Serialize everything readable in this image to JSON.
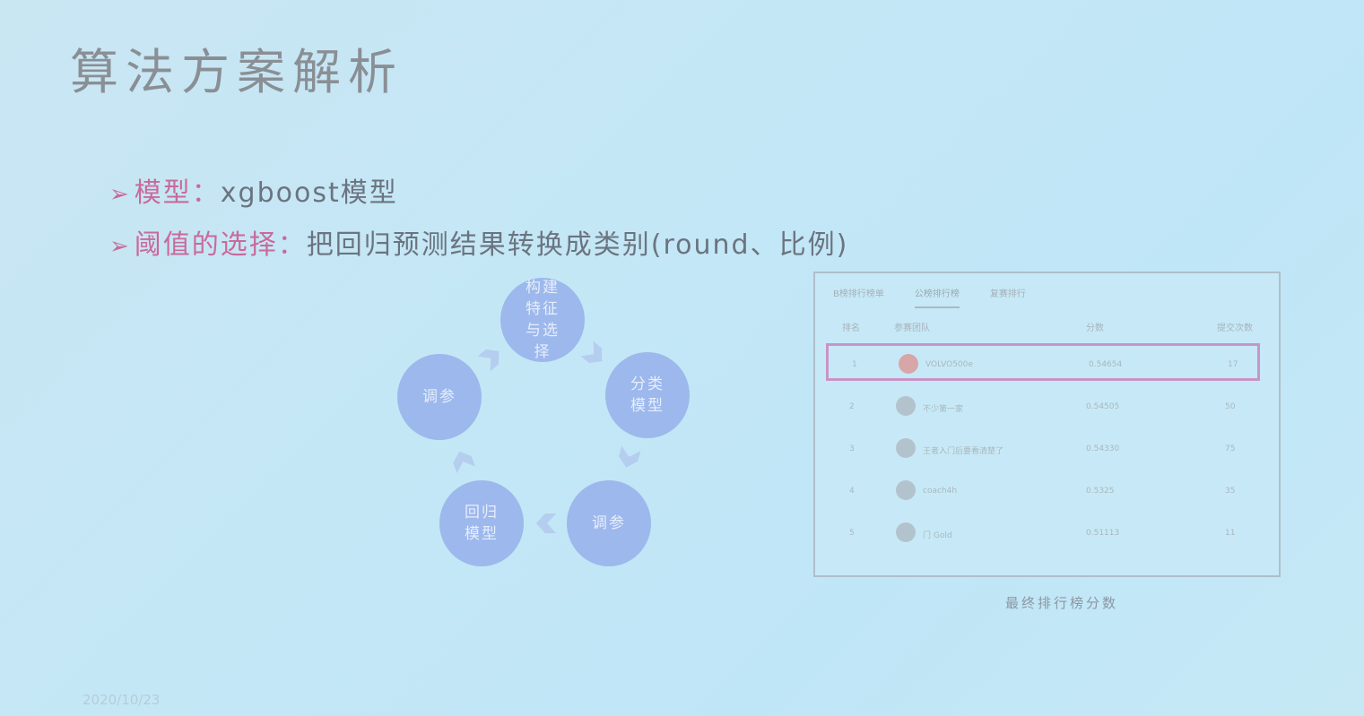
{
  "slide": {
    "title": "算法方案解析",
    "bullets": [
      {
        "arrow": "➢",
        "key": "模型：",
        "text": "xgboost模型"
      },
      {
        "arrow": "➢",
        "key": "阈值的选择：",
        "text": "把回归预测结果转换成类别(round、比例)"
      }
    ],
    "date": "2020/10/23"
  },
  "cycle": {
    "color": "#9db8ec",
    "nodes": [
      {
        "id": "feature",
        "label": "构建 特征 与选 择"
      },
      {
        "id": "classification",
        "label": "分类 模型"
      },
      {
        "id": "tune-1",
        "label": "调参"
      },
      {
        "id": "regression",
        "label": "回归 模型"
      },
      {
        "id": "tune-2",
        "label": "调参"
      }
    ]
  },
  "leaderboard": {
    "tabs": [
      "B榜排行榜单",
      "公榜排行榜",
      "复赛排行"
    ],
    "active_tab": 1,
    "columns": [
      "排名",
      "参赛团队",
      "分数",
      "提交次数"
    ],
    "rows": [
      {
        "rank": "1",
        "team": "VOLVO500e",
        "score": "0.54654",
        "submits": "17",
        "highlight": true
      },
      {
        "rank": "2",
        "team": "不少第一家",
        "score": "0.54505",
        "submits": "50",
        "highlight": false
      },
      {
        "rank": "3",
        "team": "王者入门后要看清楚了",
        "score": "0.54330",
        "submits": "75",
        "highlight": false
      },
      {
        "rank": "4",
        "team": "coach4h",
        "score": "0.5325",
        "submits": "35",
        "highlight": false
      },
      {
        "rank": "5",
        "team": "门 Gold",
        "score": "0.51113",
        "submits": "11",
        "highlight": false
      }
    ],
    "caption": "最终排行榜分数",
    "highlight_color": "#c894c7"
  }
}
